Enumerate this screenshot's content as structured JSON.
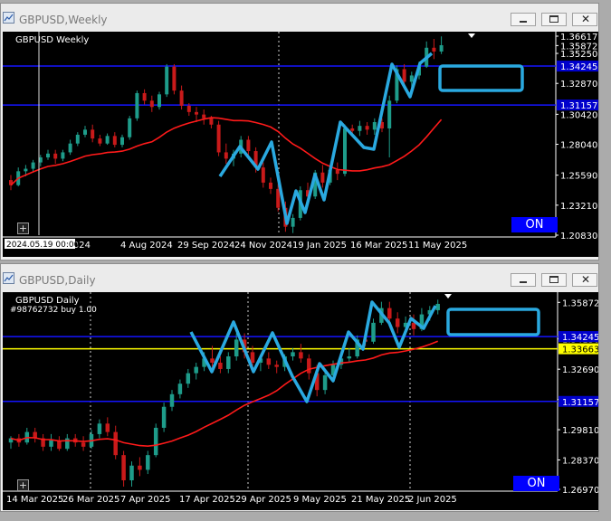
{
  "colors": {
    "background": "#000000",
    "bull": "#1e9c8a",
    "bear": "#c91a1a",
    "ma": "#ff1a1a",
    "hline": "#1414ff",
    "yellow_line": "#ffff00",
    "annotation": "#2aa9e0",
    "price_tag_blue": "#0000cc",
    "price_tag_white": "#ffffff",
    "price_tag_yellow": "#ffff00"
  },
  "weekly": {
    "title": "GBPUSD,Weekly",
    "toolbar_label": "GBPUSD Weekly",
    "on_label": "ON",
    "crosshair_date": "2024.05.19 00:00",
    "price_labels": [
      "1.36617",
      "1.35872",
      "1.35250",
      "1.32870",
      "1.30420",
      "1.28040",
      "1.25590",
      "1.23210",
      "1.20830"
    ],
    "hline_tags": [
      "1.34245",
      "1.31157"
    ],
    "date_labels": [
      "n 2024",
      "4 Aug 2024",
      "29 Sep 2024",
      "24 Nov 2024",
      "19 Jan 2025",
      "16 Mar 2025",
      "11 May 2025"
    ],
    "chart_data": {
      "type": "candlestick",
      "timeframe": "Weekly",
      "symbol": "GBPUSD",
      "ylim": [
        1.2083,
        1.36617
      ],
      "candles": [
        [
          1.252,
          1.256,
          1.244,
          1.248
        ],
        [
          1.248,
          1.262,
          1.247,
          1.259
        ],
        [
          1.259,
          1.264,
          1.255,
          1.261
        ],
        [
          1.261,
          1.268,
          1.258,
          1.266
        ],
        [
          1.266,
          1.272,
          1.263,
          1.27
        ],
        [
          1.27,
          1.276,
          1.268,
          1.273
        ],
        [
          1.273,
          1.276,
          1.265,
          1.269
        ],
        [
          1.269,
          1.276,
          1.267,
          1.274
        ],
        [
          1.274,
          1.284,
          1.272,
          1.281
        ],
        [
          1.281,
          1.29,
          1.279,
          1.288
        ],
        [
          1.288,
          1.295,
          1.286,
          1.292
        ],
        [
          1.292,
          1.296,
          1.282,
          1.285
        ],
        [
          1.285,
          1.288,
          1.279,
          1.281
        ],
        [
          1.281,
          1.289,
          1.28,
          1.287
        ],
        [
          1.287,
          1.29,
          1.278,
          1.28
        ],
        [
          1.28,
          1.288,
          1.278,
          1.286
        ],
        [
          1.286,
          1.303,
          1.284,
          1.301
        ],
        [
          1.301,
          1.323,
          1.299,
          1.321
        ],
        [
          1.321,
          1.324,
          1.312,
          1.315
        ],
        [
          1.315,
          1.319,
          1.306,
          1.31
        ],
        [
          1.31,
          1.322,
          1.308,
          1.32
        ],
        [
          1.32,
          1.344,
          1.318,
          1.342
        ],
        [
          1.342,
          1.344,
          1.32,
          1.323
        ],
        [
          1.323,
          1.327,
          1.308,
          1.311
        ],
        [
          1.311,
          1.313,
          1.303,
          1.306
        ],
        [
          1.306,
          1.31,
          1.298,
          1.304
        ],
        [
          1.304,
          1.308,
          1.296,
          1.301
        ],
        [
          1.301,
          1.303,
          1.293,
          1.296
        ],
        [
          1.296,
          1.299,
          1.271,
          1.274
        ],
        [
          1.274,
          1.281,
          1.265,
          1.269
        ],
        [
          1.269,
          1.276,
          1.263,
          1.273
        ],
        [
          1.273,
          1.287,
          1.27,
          1.284
        ],
        [
          1.284,
          1.287,
          1.272,
          1.275
        ],
        [
          1.275,
          1.278,
          1.258,
          1.262
        ],
        [
          1.262,
          1.266,
          1.246,
          1.25
        ],
        [
          1.25,
          1.254,
          1.241,
          1.245
        ],
        [
          1.245,
          1.249,
          1.227,
          1.23
        ],
        [
          1.23,
          1.235,
          1.211,
          1.215
        ],
        [
          1.215,
          1.225,
          1.21,
          1.222
        ],
        [
          1.222,
          1.247,
          1.22,
          1.244
        ],
        [
          1.244,
          1.25,
          1.236,
          1.239
        ],
        [
          1.239,
          1.26,
          1.237,
          1.258
        ],
        [
          1.258,
          1.264,
          1.246,
          1.25
        ],
        [
          1.25,
          1.263,
          1.248,
          1.26
        ],
        [
          1.26,
          1.266,
          1.252,
          1.257
        ],
        [
          1.257,
          1.296,
          1.255,
          1.293
        ],
        [
          1.293,
          1.296,
          1.288,
          1.291
        ],
        [
          1.291,
          1.299,
          1.287,
          1.295
        ],
        [
          1.295,
          1.298,
          1.288,
          1.292
        ],
        [
          1.292,
          1.301,
          1.288,
          1.298
        ],
        [
          1.298,
          1.301,
          1.29,
          1.293
        ],
        [
          1.293,
          1.319,
          1.27,
          1.315
        ],
        [
          1.315,
          1.343,
          1.313,
          1.34
        ],
        [
          1.34,
          1.344,
          1.326,
          1.33
        ],
        [
          1.33,
          1.338,
          1.32,
          1.335
        ],
        [
          1.335,
          1.346,
          1.332,
          1.342
        ],
        [
          1.342,
          1.362,
          1.341,
          1.357
        ],
        [
          1.357,
          1.364,
          1.348,
          1.354
        ],
        [
          1.354,
          1.366,
          1.352,
          1.359
        ]
      ]
    }
  },
  "daily": {
    "title": "GBPUSD,Daily",
    "toolbar_label": "GBPUSD Daily",
    "order_label": "#98762732 buy 1.00",
    "on_label": "ON",
    "price_labels": [
      "1.35872",
      "1.34130",
      "1.32690",
      "1.31250",
      "1.29810",
      "1.28370",
      "1.26970"
    ],
    "hline_tags": [
      "1.34245",
      "1.33663",
      "1.31157"
    ],
    "date_labels": [
      "14 Mar 2025",
      "26 Mar 2025",
      "7 Apr 2025",
      "17 Apr 2025",
      "29 Apr 2025",
      "9 May 2025",
      "21 May 2025",
      "2 Jun 2025"
    ],
    "chart_data": {
      "type": "candlestick",
      "timeframe": "Daily",
      "symbol": "GBPUSD",
      "ylim": [
        1.2697,
        1.361
      ],
      "candles": [
        [
          1.292,
          1.295,
          1.289,
          1.294
        ],
        [
          1.294,
          1.296,
          1.29,
          1.292
        ],
        [
          1.292,
          1.299,
          1.291,
          1.297
        ],
        [
          1.297,
          1.299,
          1.292,
          1.294
        ],
        [
          1.294,
          1.296,
          1.288,
          1.29
        ],
        [
          1.29,
          1.296,
          1.288,
          1.293
        ],
        [
          1.293,
          1.295,
          1.288,
          1.289
        ],
        [
          1.289,
          1.296,
          1.288,
          1.294
        ],
        [
          1.294,
          1.296,
          1.29,
          1.292
        ],
        [
          1.292,
          1.295,
          1.288,
          1.29
        ],
        [
          1.29,
          1.298,
          1.289,
          1.296
        ],
        [
          1.296,
          1.303,
          1.294,
          1.301
        ],
        [
          1.301,
          1.304,
          1.295,
          1.297
        ],
        [
          1.297,
          1.3,
          1.284,
          1.286
        ],
        [
          1.286,
          1.288,
          1.271,
          1.274
        ],
        [
          1.274,
          1.283,
          1.271,
          1.281
        ],
        [
          1.281,
          1.285,
          1.276,
          1.279
        ],
        [
          1.279,
          1.288,
          1.277,
          1.286
        ],
        [
          1.286,
          1.301,
          1.285,
          1.299
        ],
        [
          1.299,
          1.311,
          1.297,
          1.309
        ],
        [
          1.309,
          1.317,
          1.307,
          1.315
        ],
        [
          1.315,
          1.322,
          1.313,
          1.32
        ],
        [
          1.32,
          1.327,
          1.318,
          1.325
        ],
        [
          1.325,
          1.33,
          1.322,
          1.328
        ],
        [
          1.328,
          1.335,
          1.326,
          1.332
        ],
        [
          1.332,
          1.338,
          1.328,
          1.33
        ],
        [
          1.33,
          1.333,
          1.325,
          1.327
        ],
        [
          1.327,
          1.335,
          1.325,
          1.333
        ],
        [
          1.333,
          1.344,
          1.331,
          1.341
        ],
        [
          1.341,
          1.344,
          1.332,
          1.335
        ],
        [
          1.335,
          1.338,
          1.328,
          1.33
        ],
        [
          1.33,
          1.334,
          1.326,
          1.332
        ],
        [
          1.332,
          1.335,
          1.327,
          1.329
        ],
        [
          1.329,
          1.331,
          1.325,
          1.328
        ],
        [
          1.328,
          1.334,
          1.326,
          1.333
        ],
        [
          1.333,
          1.337,
          1.331,
          1.335
        ],
        [
          1.335,
          1.339,
          1.33,
          1.332
        ],
        [
          1.332,
          1.334,
          1.322,
          1.325
        ],
        [
          1.325,
          1.329,
          1.314,
          1.317
        ],
        [
          1.317,
          1.326,
          1.315,
          1.324
        ],
        [
          1.324,
          1.331,
          1.323,
          1.329
        ],
        [
          1.329,
          1.335,
          1.327,
          1.332
        ],
        [
          1.332,
          1.337,
          1.33,
          1.333
        ],
        [
          1.333,
          1.343,
          1.332,
          1.341
        ],
        [
          1.341,
          1.345,
          1.338,
          1.34
        ],
        [
          1.34,
          1.351,
          1.339,
          1.349
        ],
        [
          1.349,
          1.359,
          1.348,
          1.356
        ],
        [
          1.356,
          1.359,
          1.348,
          1.351
        ],
        [
          1.351,
          1.354,
          1.344,
          1.347
        ],
        [
          1.347,
          1.352,
          1.343,
          1.349
        ],
        [
          1.349,
          1.353,
          1.343,
          1.346
        ],
        [
          1.346,
          1.356,
          1.345,
          1.353
        ],
        [
          1.353,
          1.357,
          1.35,
          1.355
        ],
        [
          1.355,
          1.36,
          1.353,
          1.358
        ]
      ]
    }
  }
}
